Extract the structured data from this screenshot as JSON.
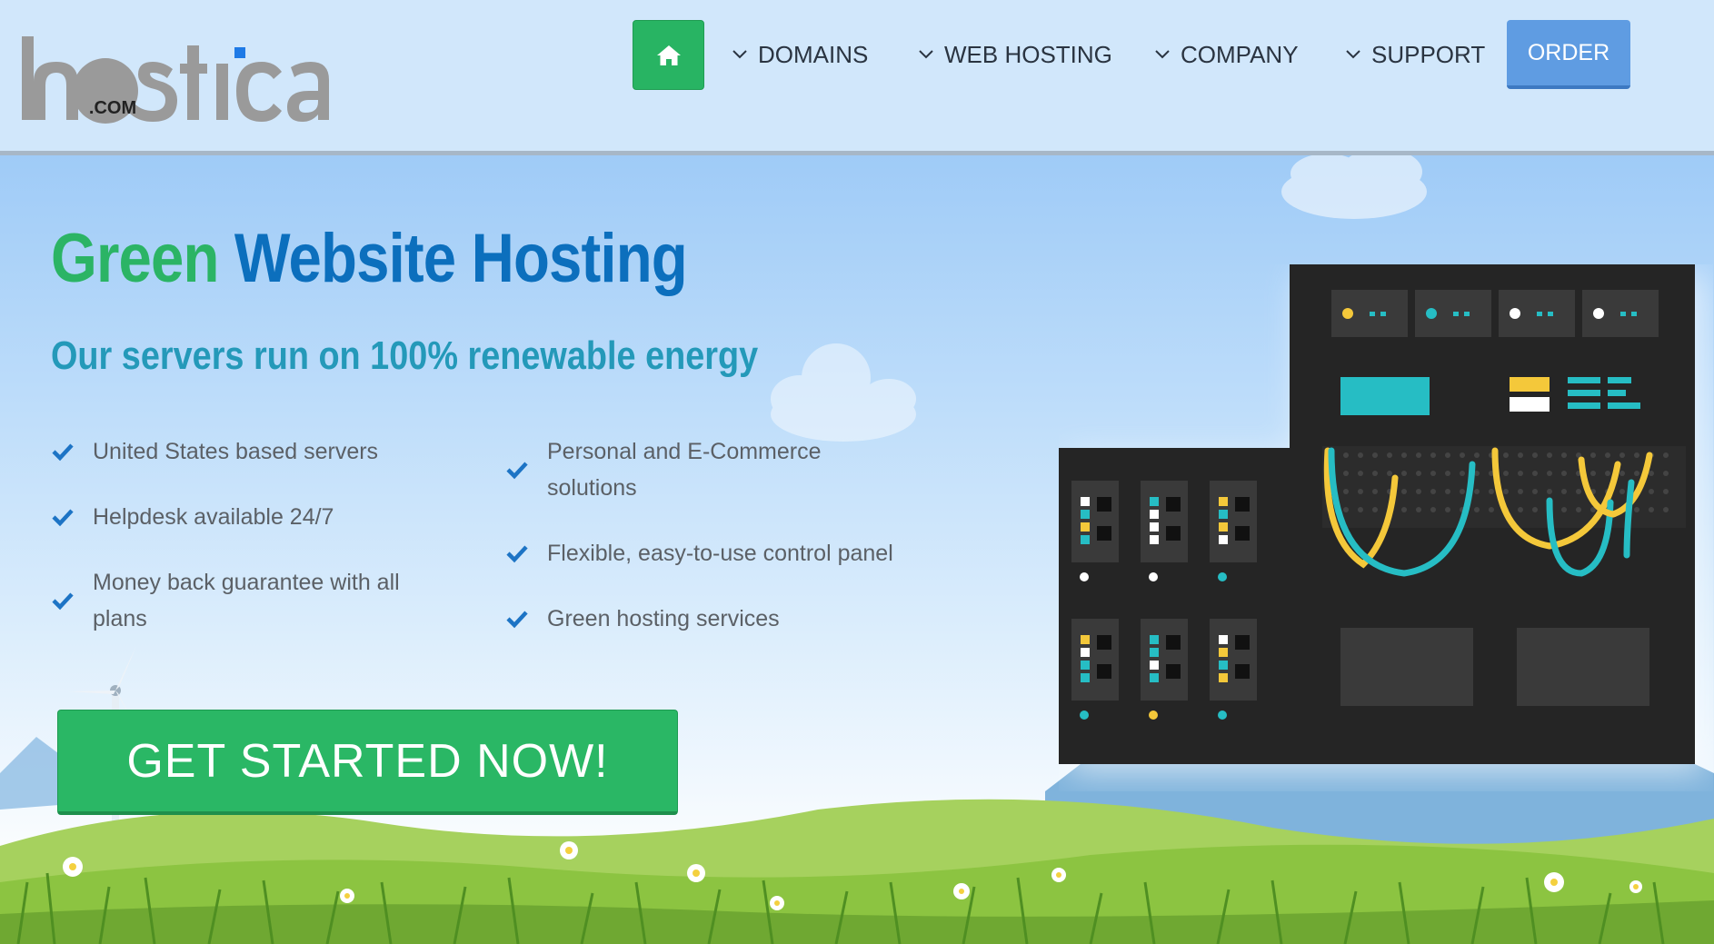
{
  "brand": {
    "logo_main": "hstica",
    "logo_com": ".COM"
  },
  "nav": {
    "home_icon": "house-icon",
    "items": [
      {
        "label": "DOMAINS",
        "icon": "chevron-down-icon"
      },
      {
        "label": "WEB HOSTING",
        "icon": "chevron-down-icon"
      },
      {
        "label": "COMPANY",
        "icon": "chevron-down-icon"
      },
      {
        "label": "SUPPORT",
        "icon": "chevron-down-icon"
      }
    ],
    "order_label": "ORDER"
  },
  "hero": {
    "headline_green": "Green",
    "headline_blue": "Website Hosting",
    "subheadline": "Our servers run on 100% renewable energy",
    "features_left": [
      "United States based servers",
      "Helpdesk available 24/7",
      "Money back guarantee with all plans"
    ],
    "features_right": [
      "Personal and E-Commerce solutions",
      "Flexible, easy-to-use control panel",
      "Green hosting services"
    ],
    "check_icon": "checkmark-icon",
    "cta_label": "GET STARTED NOW!"
  },
  "colors": {
    "header_bg": "#d1e7fb",
    "accent_green": "#2ab765",
    "accent_blue": "#0c6fbd",
    "subhead_teal": "#2499b9",
    "order_blue": "#5f9ce2",
    "server_dark": "#252525",
    "server_teal": "#26bdc4",
    "server_yellow": "#f4c83a"
  }
}
